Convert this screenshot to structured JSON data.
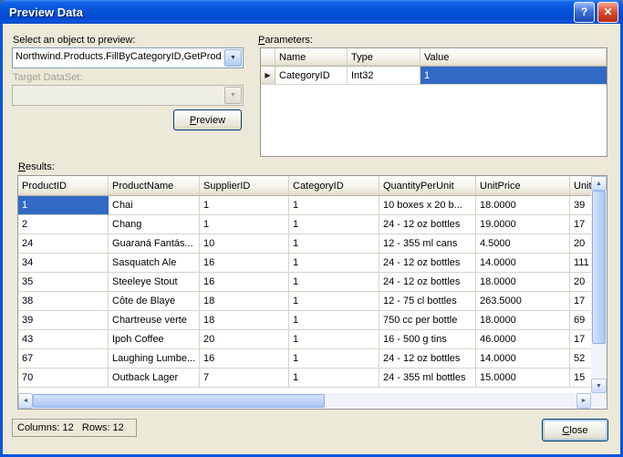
{
  "window": {
    "title": "Preview Data"
  },
  "titlebar": {
    "help_icon": "?",
    "close_icon": "✕"
  },
  "selector": {
    "label": "Select an object to preview:",
    "value": "Northwind.Products.FillByCategoryID,GetProd",
    "target_label": "Target DataSet:",
    "target_value": ""
  },
  "buttons": {
    "preview": "Preview",
    "close": "Close"
  },
  "parameters": {
    "label": "Parameters:",
    "columns": [
      "Name",
      "Type",
      "Value"
    ],
    "rows": [
      [
        "CategoryID",
        "Int32",
        "1"
      ]
    ],
    "selected_cell": {
      "row": 0,
      "col": 2
    },
    "row_indicator_icon": "▶"
  },
  "results": {
    "label": "Results:",
    "columns": [
      "ProductID",
      "ProductName",
      "SupplierID",
      "CategoryID",
      "QuantityPerUnit",
      "UnitPrice",
      "UnitsI"
    ],
    "rows": [
      [
        "1",
        "Chai",
        "1",
        "1",
        "10 boxes x 20 b...",
        "18.0000",
        "39"
      ],
      [
        "2",
        "Chang",
        "1",
        "1",
        "24 - 12 oz bottles",
        "19.0000",
        "17"
      ],
      [
        "24",
        "Guaraná Fantás...",
        "10",
        "1",
        "12 - 355 ml cans",
        "4.5000",
        "20"
      ],
      [
        "34",
        "Sasquatch Ale",
        "16",
        "1",
        "24 - 12 oz bottles",
        "14.0000",
        "111"
      ],
      [
        "35",
        "Steeleye Stout",
        "16",
        "1",
        "24 - 12 oz bottles",
        "18.0000",
        "20"
      ],
      [
        "38",
        "Côte de Blaye",
        "18",
        "1",
        "12 - 75 cl bottles",
        "263.5000",
        "17"
      ],
      [
        "39",
        "Chartreuse verte",
        "18",
        "1",
        "750 cc per bottle",
        "18.0000",
        "69"
      ],
      [
        "43",
        "Ipoh Coffee",
        "20",
        "1",
        "16 - 500 g tins",
        "46.0000",
        "17"
      ],
      [
        "67",
        "Laughing Lumbe...",
        "16",
        "1",
        "24 - 12 oz bottles",
        "14.0000",
        "52"
      ],
      [
        "70",
        "Outback Lager",
        "7",
        "1",
        "24 - 355 ml bottles",
        "15.0000",
        "15"
      ]
    ],
    "selected_cell": {
      "row": 0,
      "col": 0
    }
  },
  "status": {
    "text": "Columns: 12   Rows: 12"
  },
  "icons": {
    "combo_arrow": "▼",
    "arrow_up": "▲",
    "arrow_down": "▼",
    "arrow_left": "◄",
    "arrow_right": "►"
  },
  "colors": {
    "selection": "#316AC5",
    "window_border": "#0855DD"
  }
}
